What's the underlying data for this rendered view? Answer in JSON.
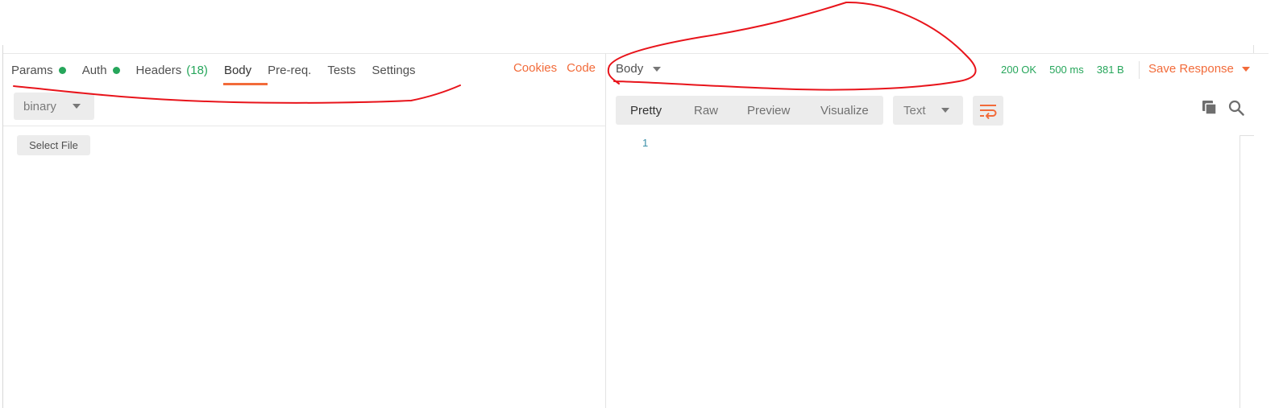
{
  "request": {
    "tabs": [
      {
        "label": "Params",
        "dot": true
      },
      {
        "label": "Auth",
        "dot": true
      },
      {
        "label": "Headers",
        "count": "(18)"
      },
      {
        "label": "Body",
        "active": true
      },
      {
        "label": "Pre-req."
      },
      {
        "label": "Tests"
      },
      {
        "label": "Settings"
      }
    ],
    "links": {
      "cookies": "Cookies",
      "code": "Code"
    },
    "body_type": "binary",
    "select_file_label": "Select File"
  },
  "response": {
    "section_label": "Body",
    "status": "200 OK",
    "time": "500 ms",
    "size": "381 B",
    "save_label": "Save Response",
    "view_modes": [
      "Pretty",
      "Raw",
      "Preview",
      "Visualize"
    ],
    "active_view": "Pretty",
    "format": "Text",
    "line_numbers": [
      "1"
    ]
  },
  "colors": {
    "accent": "#f26b3a",
    "success": "#26a65b",
    "annotation": "#e8141b"
  },
  "icons": [
    "chevron-down-icon",
    "wrap-lines-icon",
    "copy-icon",
    "search-icon"
  ]
}
